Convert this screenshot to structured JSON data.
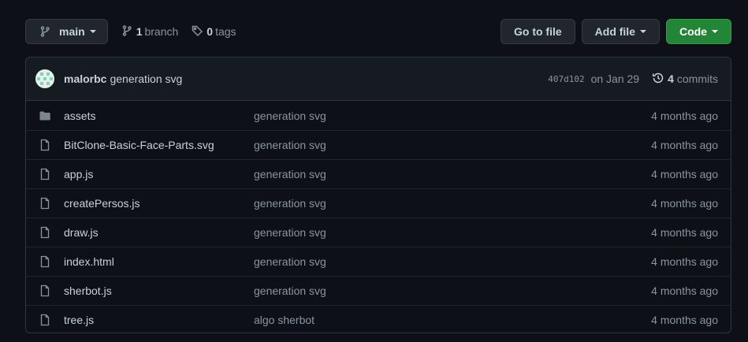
{
  "toolbar": {
    "branch_name": "main",
    "branch_count": "1",
    "branch_word": "branch",
    "tag_count": "0",
    "tag_word": "tags",
    "go_to_file": "Go to file",
    "add_file": "Add file",
    "code": "Code"
  },
  "commit": {
    "author": "malorbc",
    "message": "generation svg",
    "sha": "407d102",
    "date": "on Jan 29",
    "count": "4",
    "count_word": "commits"
  },
  "files": [
    {
      "name": "assets",
      "type": "folder",
      "message": "generation svg",
      "age": "4 months ago"
    },
    {
      "name": "BitClone-Basic-Face-Parts.svg",
      "type": "file",
      "message": "generation svg",
      "age": "4 months ago"
    },
    {
      "name": "app.js",
      "type": "file",
      "message": "generation svg",
      "age": "4 months ago"
    },
    {
      "name": "createPersos.js",
      "type": "file",
      "message": "generation svg",
      "age": "4 months ago"
    },
    {
      "name": "draw.js",
      "type": "file",
      "message": "generation svg",
      "age": "4 months ago"
    },
    {
      "name": "index.html",
      "type": "file",
      "message": "generation svg",
      "age": "4 months ago"
    },
    {
      "name": "sherbot.js",
      "type": "file",
      "message": "generation svg",
      "age": "4 months ago"
    },
    {
      "name": "tree.js",
      "type": "file",
      "message": "algo sherbot",
      "age": "4 months ago"
    }
  ],
  "colors": {
    "background": "#0d1117",
    "header_background": "#161b22",
    "border": "#30363d",
    "code_button": "#238636",
    "muted_text": "#8b949e",
    "text": "#c9d1d9"
  },
  "icons": {
    "branch": "git-branch-icon",
    "tag": "tag-icon",
    "history": "history-icon",
    "folder": "folder-icon",
    "file": "file-icon"
  }
}
